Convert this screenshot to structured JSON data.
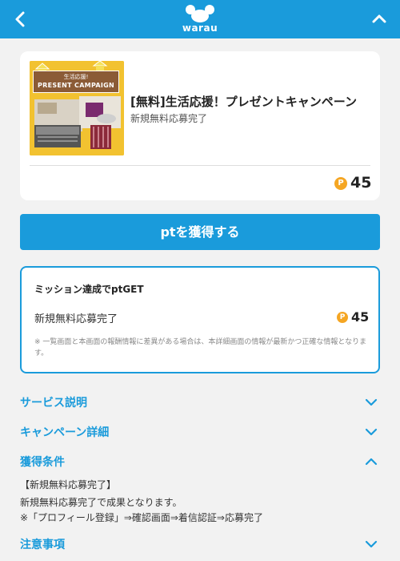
{
  "header": {
    "logo_text": "warau",
    "back_icon": "chevron-left-icon",
    "up_icon": "chevron-up-icon",
    "brand_color": "#1a9bdb"
  },
  "campaign": {
    "banner_line1": "生活応援!",
    "banner_line2": "PRESENT CAMPAIGN",
    "title": "[無料]生活応援！プレゼントキャンペーン",
    "subtitle": "新規無料応募完了",
    "points": "45",
    "coin_label": "P"
  },
  "get_button": {
    "label": "ptを獲得する"
  },
  "mission": {
    "title": "ミッション達成でptGET",
    "item_label": "新規無料応募完了",
    "points": "45",
    "note": "※ 一覧画面と本画面の報酬情報に差異がある場合は、本詳細画面の情報が最新かつ正確な情報となります。"
  },
  "sections": {
    "service": {
      "label": "サービス説明",
      "state": "collapsed"
    },
    "campaign_detail": {
      "label": "キャンペーン詳細",
      "state": "collapsed"
    },
    "conditions": {
      "label": "獲得条件",
      "state": "expanded"
    },
    "notes": {
      "label": "注意事項",
      "state": "collapsed"
    }
  },
  "conditions": {
    "line1": "【新規無料応募完了】",
    "line2": "新規無料応募完了で成果となります。",
    "line3": "※「プロフィール登録」⇒確認画面⇒着信認証⇒応募完了"
  }
}
